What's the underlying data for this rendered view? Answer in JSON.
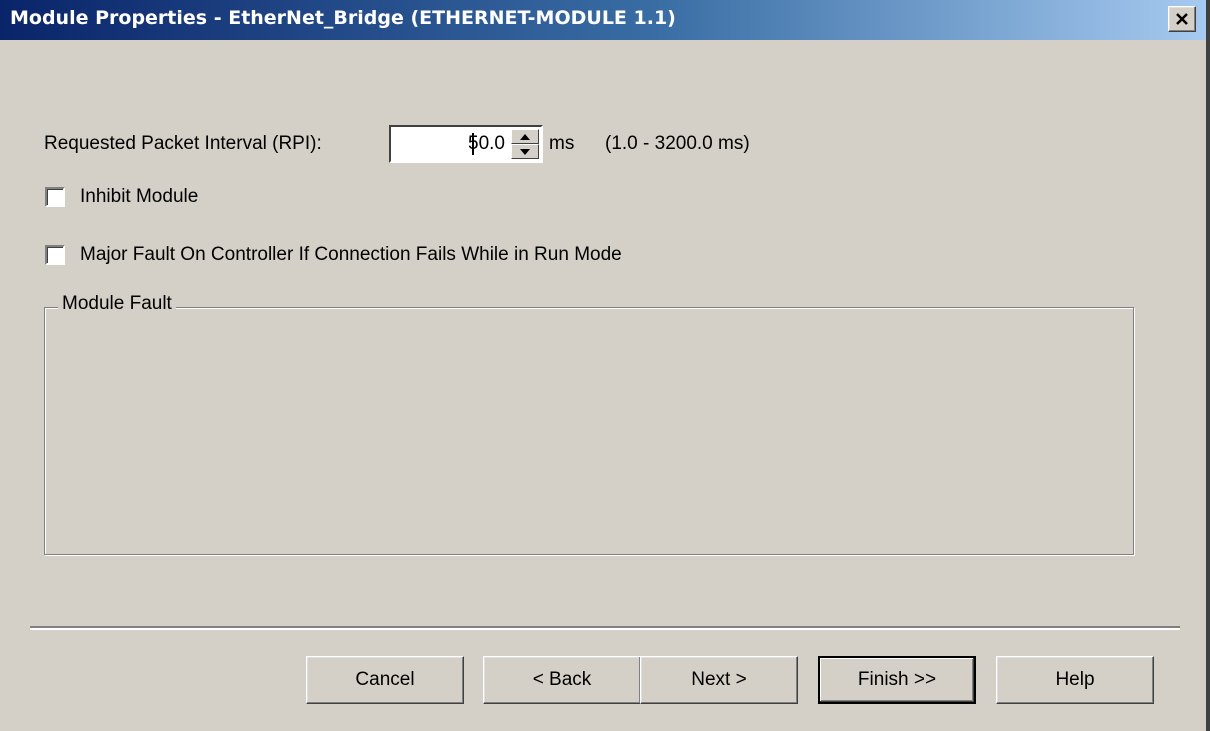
{
  "window": {
    "title": "Module Properties - EtherNet_Bridge (ETHERNET-MODULE 1.1)",
    "close_glyph": "✕",
    "close_icon": "close-icon"
  },
  "rpi": {
    "label": "Requested Packet Interval (RPI):",
    "value": "50.0",
    "unit": "ms",
    "range": "(1.0 - 3200.0 ms)",
    "spinner_icons": [
      "spin-up-icon",
      "spin-down-icon"
    ]
  },
  "options": {
    "inhibit_label": "Inhibit Module",
    "inhibit_checked": false,
    "major_fault_label": "Major Fault On Controller If Connection Fails While in Run Mode",
    "major_fault_checked": false
  },
  "fault_group": {
    "title": "Module Fault"
  },
  "buttons": {
    "cancel": "Cancel",
    "back": "< Back",
    "next": "Next >",
    "finish": "Finish >>",
    "help": "Help"
  },
  "colors": {
    "face": "#d4d0c8",
    "title_start": "#0a246a",
    "title_end": "#a6caf0"
  }
}
